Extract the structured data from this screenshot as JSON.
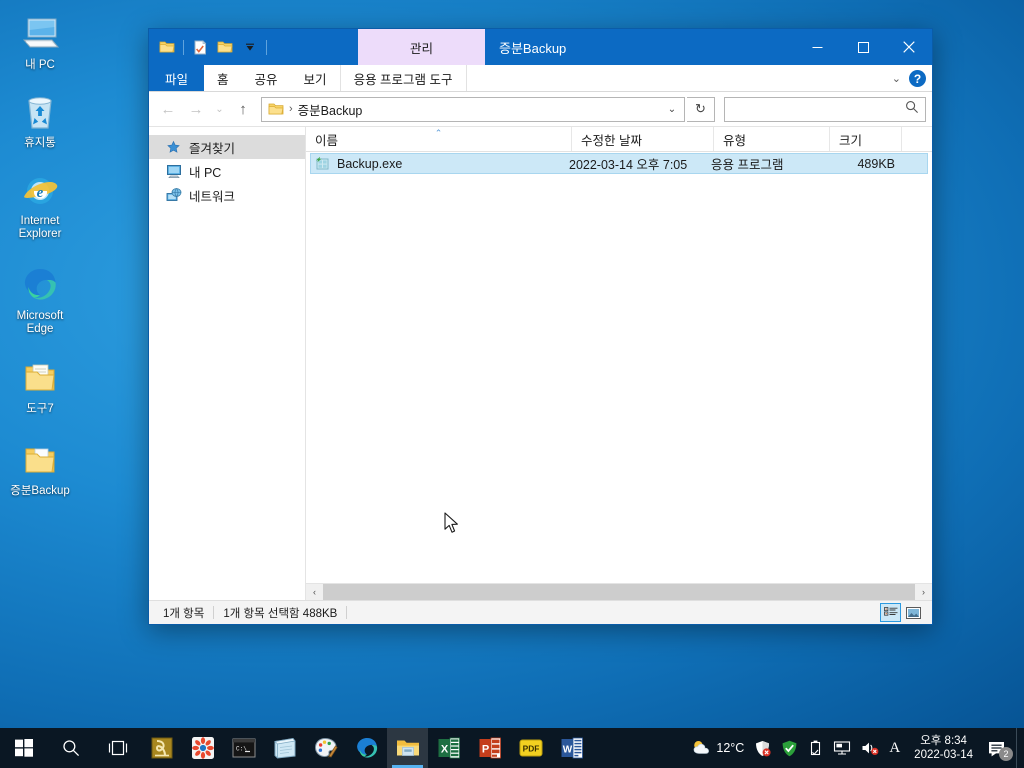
{
  "desktop": {
    "icons": [
      {
        "label": "내 PC",
        "icon": "my-computer-icon"
      },
      {
        "label": "휴지통",
        "icon": "recycle-bin-icon"
      },
      {
        "label": "Internet Explorer",
        "icon": "internet-explorer-icon"
      },
      {
        "label": "Microsoft Edge",
        "icon": "microsoft-edge-icon"
      },
      {
        "label": "도구7",
        "icon": "folder-icon"
      },
      {
        "label": "증분Backup",
        "icon": "folder-icon"
      }
    ]
  },
  "explorer": {
    "title": "증분Backup",
    "quick_access": [
      {
        "name": "folder-icon"
      },
      {
        "name": "properties-icon"
      },
      {
        "name": "new-folder-icon"
      },
      {
        "name": "chevron-down-icon"
      }
    ],
    "window_controls": {
      "minimize": "—",
      "maximize": "▢",
      "close": "✕"
    },
    "contextual_tab_header": "관리",
    "ribbon_tabs": [
      {
        "label": "파일",
        "active": true
      },
      {
        "label": "홈",
        "active": false
      },
      {
        "label": "공유",
        "active": false
      },
      {
        "label": "보기",
        "active": false
      },
      {
        "label": "응용 프로그램 도구",
        "active": false
      }
    ],
    "ribbon_collapse_label": "⌄",
    "help_label": "?",
    "nav": {
      "back": "←",
      "forward": "→",
      "recent": "⌄",
      "up": "↑",
      "breadcrumb": [
        "증분Backup"
      ],
      "breadcrumb_separator": "›",
      "address_dropdown": "⌄",
      "refresh": "↻"
    },
    "search": {
      "value": "",
      "placeholder": ""
    },
    "nav_pane": [
      {
        "label": "즐겨찾기",
        "icon": "star-icon",
        "selected": true
      },
      {
        "label": "내 PC",
        "icon": "my-computer-icon",
        "selected": false
      },
      {
        "label": "네트워크",
        "icon": "network-icon",
        "selected": false
      }
    ],
    "columns": [
      {
        "label": "이름",
        "sorted": true,
        "sort_caret": "⌃"
      },
      {
        "label": "수정한 날짜",
        "sorted": false
      },
      {
        "label": "유형",
        "sorted": false
      },
      {
        "label": "크기",
        "sorted": false
      }
    ],
    "files": [
      {
        "name": "Backup.exe",
        "modified": "2022-03-14 오후 7:05",
        "type": "응용 프로그램",
        "size": "489KB",
        "icon": "application-exe-icon",
        "selected": true
      }
    ],
    "scroll": {
      "left_arrow": "‹",
      "right_arrow": "›"
    },
    "status": {
      "item_count": "1개 항목",
      "selection": "1개 항목 선택함 488KB"
    },
    "view_buttons": [
      {
        "name": "details-view-button",
        "active": true
      },
      {
        "name": "large-icons-view-button",
        "active": false
      }
    ]
  },
  "taskbar": {
    "start": "start-icon",
    "search": "search-icon",
    "task_view": "task-view-icon",
    "apps": [
      {
        "name": "app-icon-hangul",
        "running": false
      },
      {
        "name": "app-icon-photo",
        "running": false
      },
      {
        "name": "app-icon-terminal",
        "running": false
      },
      {
        "name": "app-icon-notepad",
        "running": false
      },
      {
        "name": "app-icon-paint",
        "running": false
      },
      {
        "name": "app-icon-edge",
        "running": false
      },
      {
        "name": "app-icon-file-explorer",
        "running": true
      },
      {
        "name": "app-icon-excel",
        "running": false
      },
      {
        "name": "app-icon-powerpoint",
        "running": false
      },
      {
        "name": "app-icon-pdf",
        "running": false
      },
      {
        "name": "app-icon-word",
        "running": false
      }
    ],
    "tray": {
      "weather_icon": "weather-partly-cloudy-icon",
      "temperature": "12°C",
      "icons": [
        {
          "name": "security-shield-icon"
        },
        {
          "name": "antivirus-check-icon"
        },
        {
          "name": "usb-device-icon"
        },
        {
          "name": "network-display-icon"
        },
        {
          "name": "volume-muted-icon"
        },
        {
          "name": "ime-language-icon",
          "glyph": "A"
        }
      ],
      "time": "오후 8:34",
      "date": "2022-03-14",
      "notification_icon": "notification-icon",
      "notification_count": "2"
    }
  },
  "colors": {
    "accent": "#0c6ac3",
    "taskbar": "#0a1723",
    "selection": "#cce8f7",
    "contextual_tab": "#eddcfa"
  }
}
